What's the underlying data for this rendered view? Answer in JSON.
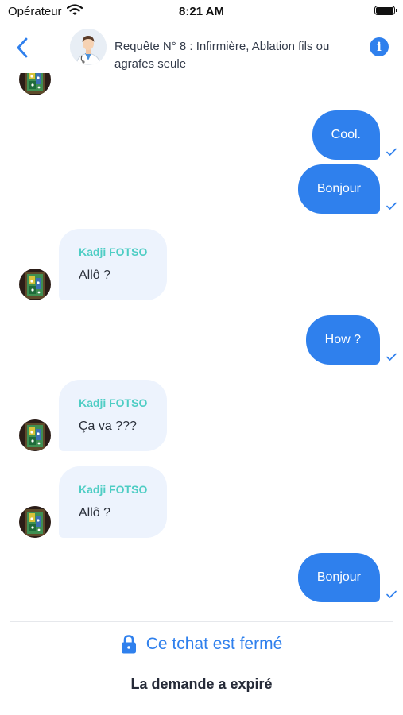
{
  "status_bar": {
    "carrier": "Opérateur",
    "time": "8:21 AM"
  },
  "header": {
    "title": "Requête N° 8 : Infirmière, Ablation fils ou agrafes seule",
    "back_icon": "chevron-left-icon",
    "info_icon": "info-icon",
    "avatar": "doctor-avatar"
  },
  "messages": [
    {
      "direction": "out",
      "text": "Cool.",
      "read": true
    },
    {
      "direction": "out",
      "text": "Bonjour",
      "read": true
    },
    {
      "direction": "in",
      "sender": "Kadji FOTSO",
      "text": "Allô ?"
    },
    {
      "direction": "out",
      "text": "How ?",
      "read": true
    },
    {
      "direction": "in",
      "sender": "Kadji FOTSO",
      "text": "Ça va ???"
    },
    {
      "direction": "in",
      "sender": "Kadji FOTSO",
      "text": "Allô ?"
    },
    {
      "direction": "out",
      "text": "Bonjour",
      "read": true
    }
  ],
  "footer": {
    "closed_label": "Ce tchat est fermé",
    "expired_label": "La demande a expiré",
    "lock_icon": "lock-icon"
  },
  "colors": {
    "accent": "#2f80ed",
    "sender_name": "#4ecdc4",
    "incoming_bubble": "#edf3fd"
  }
}
